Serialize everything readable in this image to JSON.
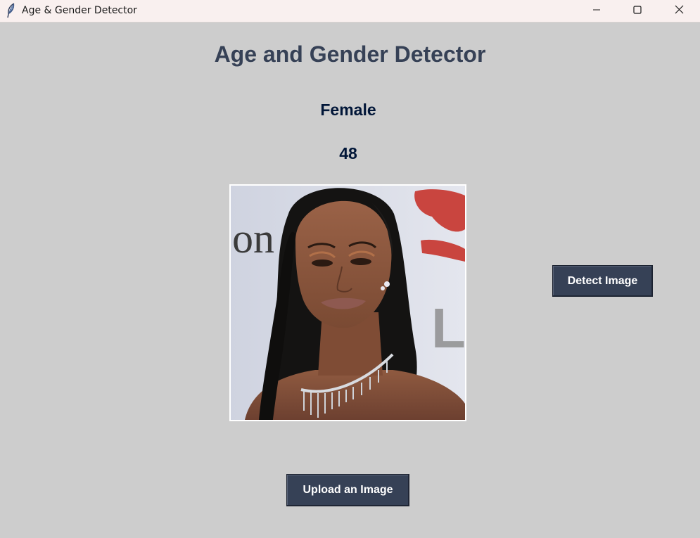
{
  "window": {
    "title": "Age & Gender Detector",
    "icon": "feather-icon",
    "controls": [
      "minimize-icon",
      "maximize-icon",
      "close-icon"
    ]
  },
  "app": {
    "heading": "Age and Gender Detector",
    "result": {
      "gender": "Female",
      "age": "48"
    },
    "image": {
      "description": "uploaded-portrait-photo"
    },
    "buttons": {
      "detect": "Detect Image",
      "upload": "Upload an Image"
    }
  },
  "colors": {
    "background": "#cdcdcd",
    "heading": "#364156",
    "result_text": "#011638",
    "button_bg": "#364156",
    "button_text": "#ffffff",
    "titlebar": "#f9f0ef"
  }
}
